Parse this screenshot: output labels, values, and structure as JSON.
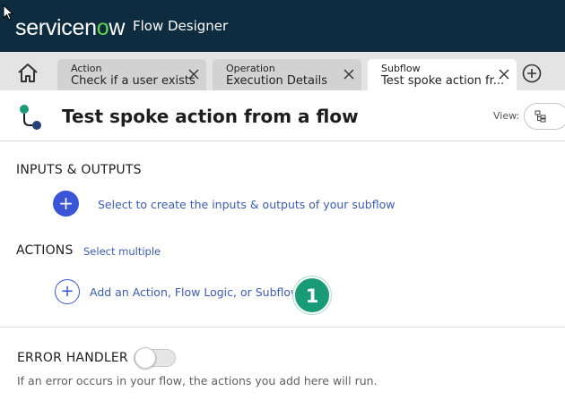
{
  "header": {
    "brand": "servicenow",
    "app_name": "Flow Designer"
  },
  "tabs": [
    {
      "type": "Action",
      "name": "Check if a user exists",
      "active": false
    },
    {
      "type": "Operation",
      "name": "Execution Details",
      "active": false
    },
    {
      "type": "Subflow",
      "name": "Test spoke action fr...",
      "active": true
    }
  ],
  "title_row": {
    "title": "Test spoke action from a flow",
    "view_label": "View:"
  },
  "inputs_outputs": {
    "heading": "INPUTS & OUTPUTS",
    "add_symbol": "+",
    "link": "Select to create the inputs & outputs of your subflow"
  },
  "actions": {
    "heading": "ACTIONS",
    "select_multiple": "Select multiple",
    "add_symbol": "+",
    "add_link": "Add an Action, Flow Logic, or Subflow",
    "step_badge": "1"
  },
  "error_handler": {
    "heading": "ERROR HANDLER",
    "enabled": false,
    "note": "If an error occurs in your flow, the actions you add here will run."
  },
  "colors": {
    "header_bg": "#0e2c3f",
    "brand_accent": "#62d84e",
    "link": "#3b5bb5",
    "primary": "#3a55d6",
    "badge": "#1a9b78"
  }
}
